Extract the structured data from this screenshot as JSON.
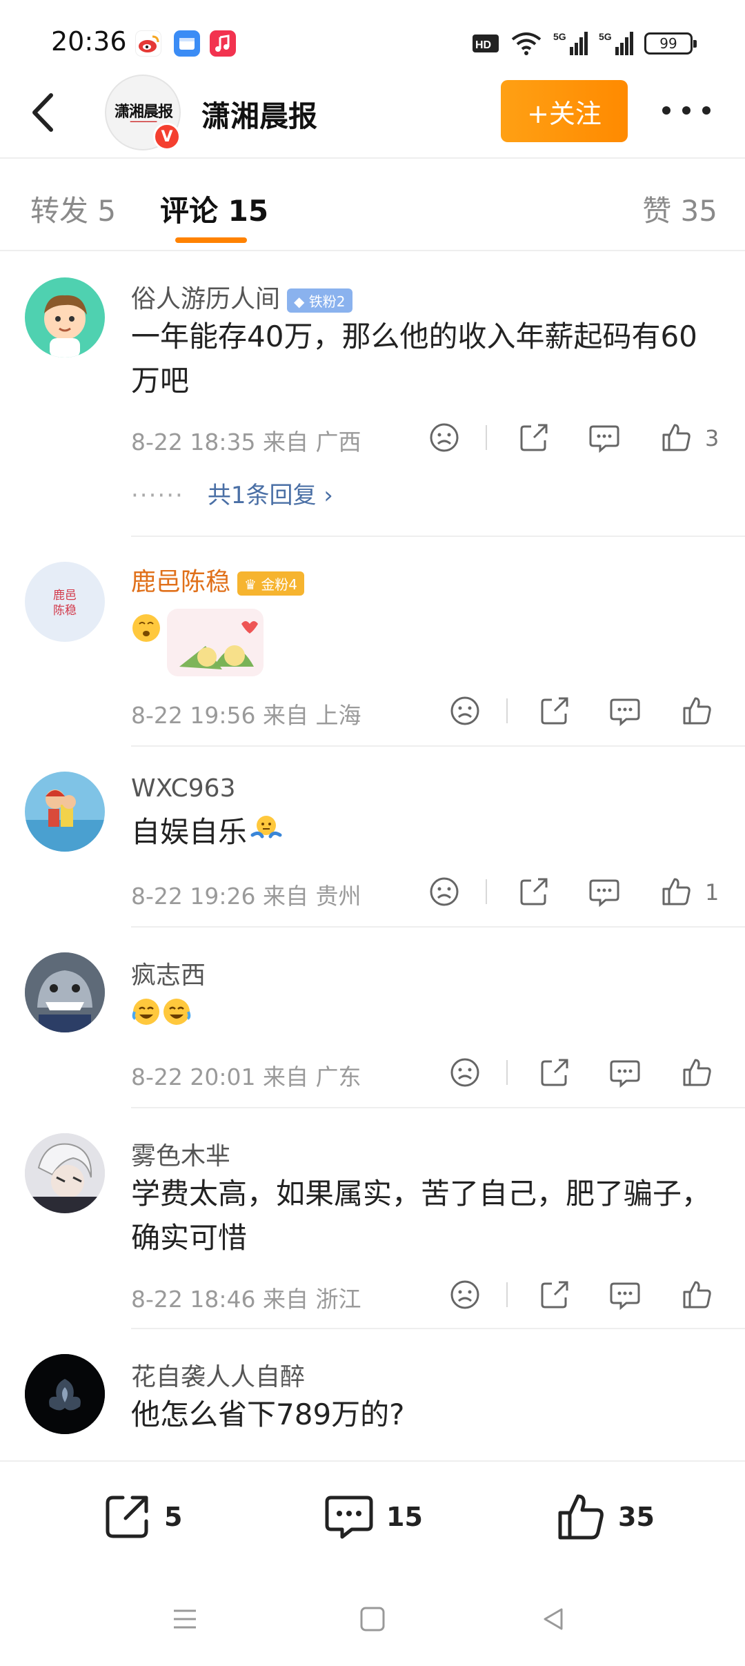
{
  "status_bar": {
    "time": "20:36",
    "battery": "99",
    "app_colors": [
      "#f44336",
      "#3b8cf5",
      "#f2334f"
    ]
  },
  "header": {
    "account_name": "潇湘晨报",
    "avatar_text": "潇湘晨报",
    "verified_mark": "V",
    "follow_label": "+关注"
  },
  "tabs": {
    "repost": "转发 5",
    "comments": "评论 15",
    "likes": "赞 35"
  },
  "comments": [
    {
      "name": "俗人游历人间",
      "badge": "铁粉2",
      "text": "一年能存40万，那么他的收入年薪起码有60万吧",
      "meta": "8-22 18:35  来自 广西",
      "likes": "3",
      "reply_link": "共1条回复 ›",
      "reply_dots": "······"
    },
    {
      "name": "鹿邑陈稳",
      "badge": "金粉4",
      "text": "",
      "meta": "8-22 19:56  来自 上海",
      "likes": "",
      "avatar_text": "鹿邑\n陈稳"
    },
    {
      "name": "WXC963",
      "text": "自娱自乐",
      "meta": "8-22 19:26  来自 贵州",
      "likes": "1"
    },
    {
      "name": "疯志西",
      "text": "",
      "meta": "8-22 20:01  来自 广东",
      "likes": ""
    },
    {
      "name": "雾色木芈",
      "text": "学费太高，如果属实，苦了自己，肥了骗子，确实可惜",
      "meta": "8-22 18:46  来自 浙江",
      "likes": ""
    },
    {
      "name": "花自袭人人自醉",
      "text": "他怎么省下789万的?",
      "meta": "",
      "likes": ""
    }
  ],
  "bottom_bar": {
    "reposts": "5",
    "comments": "15",
    "likes": "35"
  },
  "colors": {
    "accent": "#ff8200",
    "link": "#4a6fa5",
    "gold_name": "#e0701a"
  }
}
